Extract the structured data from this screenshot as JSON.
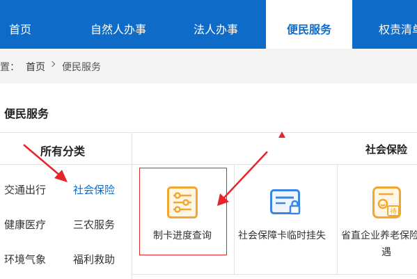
{
  "nav": {
    "items": [
      {
        "label": "首页"
      },
      {
        "label": "自然人办事"
      },
      {
        "label": "法人办事"
      },
      {
        "label": "便民服务"
      },
      {
        "label": "权责清单"
      }
    ]
  },
  "breadcrumb": {
    "prefix": "置：",
    "home": "首页",
    "current": "便民服务"
  },
  "section": {
    "title": "便民服务"
  },
  "categories": {
    "heading": "所有分类",
    "items": [
      {
        "label": "交通出行"
      },
      {
        "label": "社会保险"
      },
      {
        "label": "健康医疗"
      },
      {
        "label": "三农服务"
      },
      {
        "label": "环境气象"
      },
      {
        "label": "福利救助"
      }
    ]
  },
  "services": {
    "heading": "社会保险",
    "items": [
      {
        "label": "制卡进度查询",
        "icon": "progress-checklist-icon"
      },
      {
        "label": "社会保障卡临时挂失",
        "icon": "locked-card-icon"
      },
      {
        "label": "省直企业养老保险待",
        "label2": "遇",
        "icon": "pending-document-icon"
      }
    ]
  },
  "colors": {
    "nav_bg": "#0e6cc8",
    "highlight": "#e8242b",
    "icon_orange": "#f0a830",
    "icon_blue": "#3a86e0"
  }
}
